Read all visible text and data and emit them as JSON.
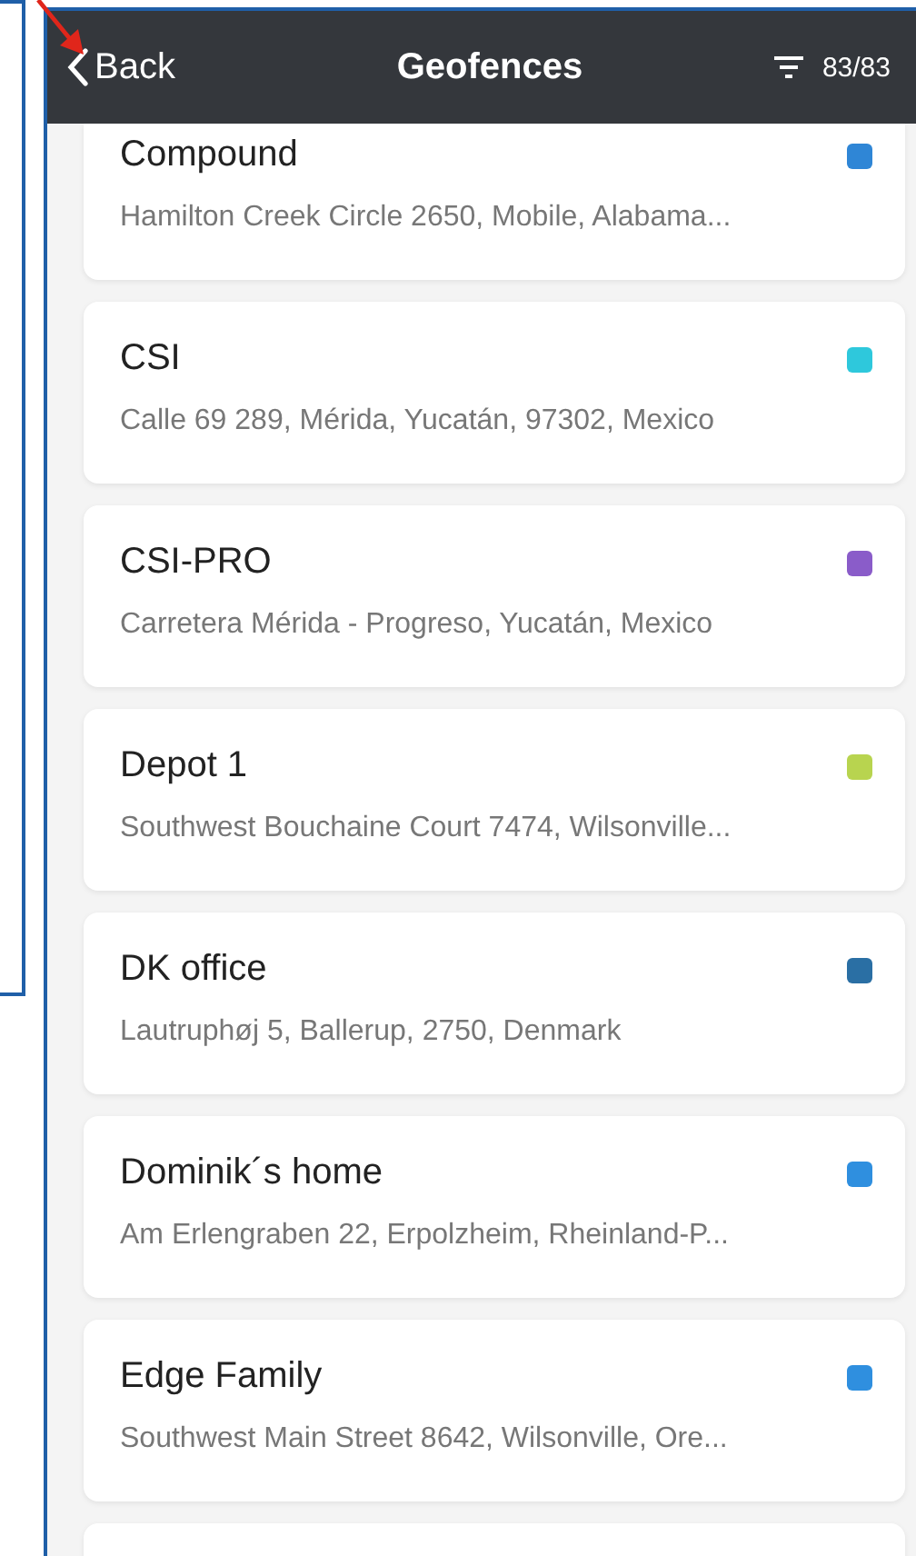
{
  "header": {
    "back": "Back",
    "title": "Geofences",
    "count": "83/83"
  },
  "geofences": [
    {
      "name": "Compound",
      "address": "Hamilton Creek Circle 2650, Mobile, Alabama...",
      "color": "#2f86d6"
    },
    {
      "name": "CSI",
      "address": "Calle 69 289, Mérida, Yucatán, 97302, Mexico",
      "color": "#2ec8dc"
    },
    {
      "name": "CSI-PRO",
      "address": "Carretera Mérida - Progreso, Yucatán, Mexico",
      "color": "#8a5cc9"
    },
    {
      "name": "Depot 1",
      "address": "Southwest Bouchaine Court 7474, Wilsonville...",
      "color": "#b8d44f"
    },
    {
      "name": "DK office",
      "address": "Lautruphøj 5, Ballerup, 2750, Denmark",
      "color": "#2a6fa4"
    },
    {
      "name": "Dominik´s home",
      "address": "Am Erlengraben 22, Erpolzheim, Rheinland-P...",
      "color": "#2f8fdf"
    },
    {
      "name": "Edge Family",
      "address": "Southwest Main Street 8642, Wilsonville, Ore...",
      "color": "#2f8fdf"
    }
  ]
}
